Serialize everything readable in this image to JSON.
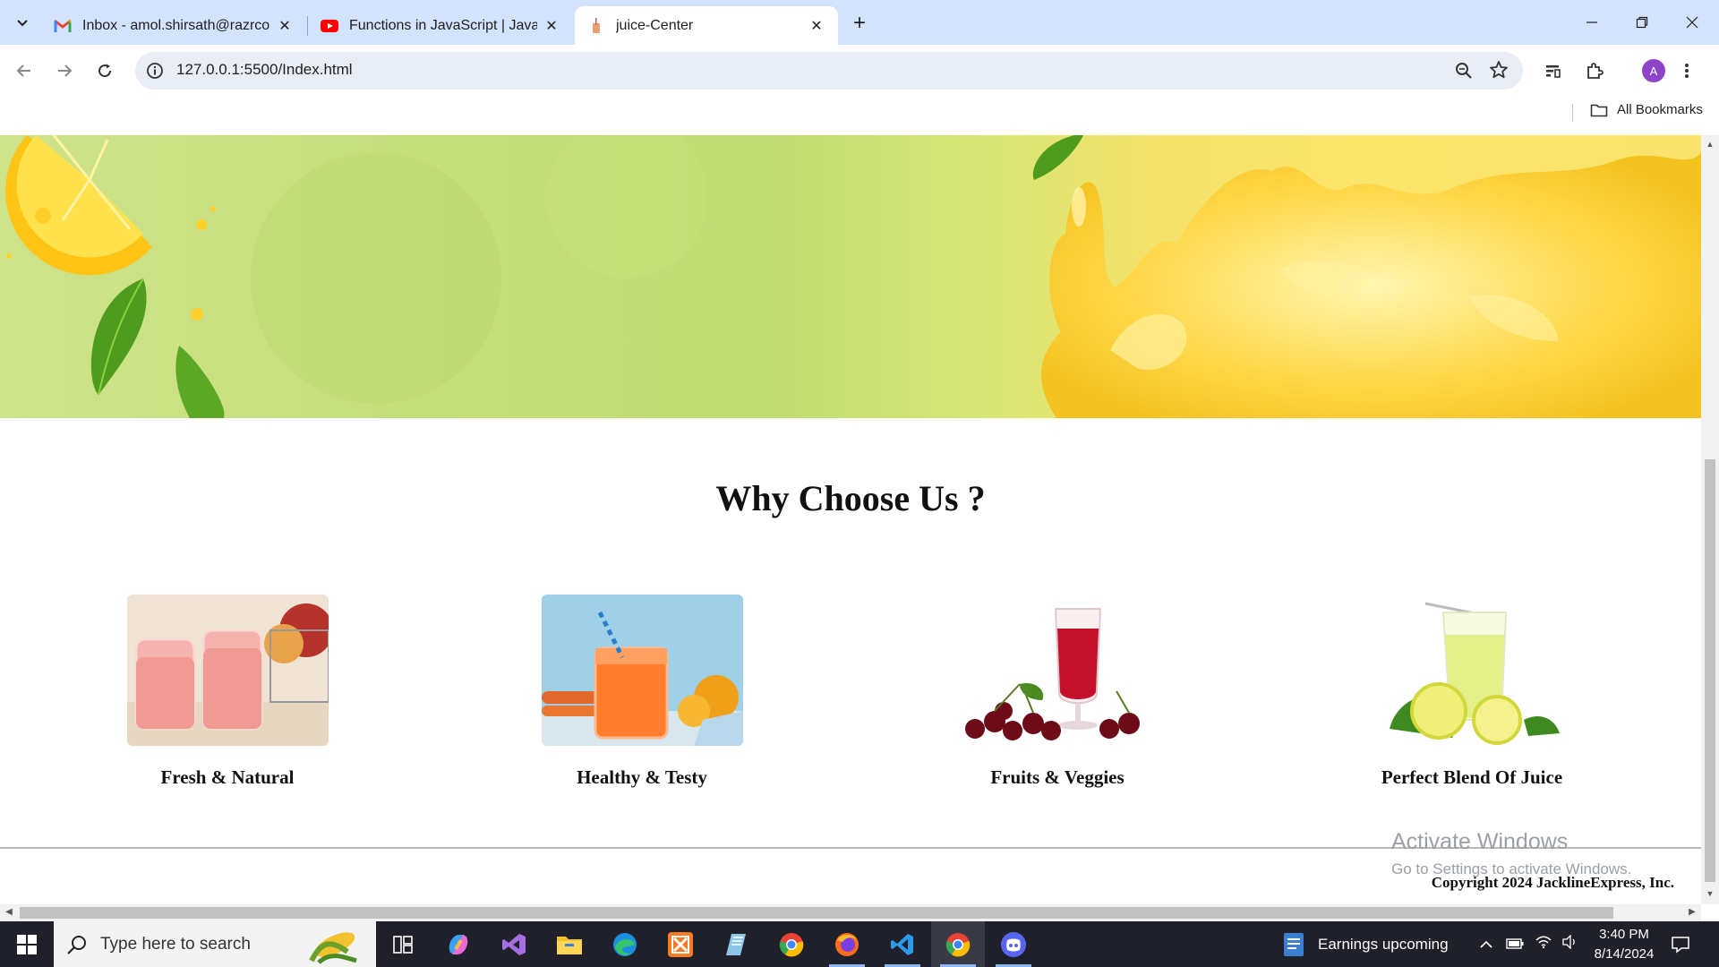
{
  "browser": {
    "tabs": [
      {
        "title": "Inbox - amol.shirsath@razrcorp",
        "favicon": "gmail-icon",
        "active": false
      },
      {
        "title": "Functions in JavaScript | JavaScr",
        "favicon": "youtube-icon",
        "active": false
      },
      {
        "title": "juice-Center",
        "favicon": "juice-icon",
        "active": true
      }
    ],
    "url": "127.0.0.1:5500/Index.html",
    "profile_initial": "A",
    "bookmarks_label": "All Bookmarks",
    "colors": {
      "tabstrip": "#d3e3fd",
      "omnibox": "#e9eef6",
      "avatar": "#8e44c8"
    }
  },
  "page": {
    "section_title": "Why Choose Us ?",
    "features": [
      {
        "caption": "Fresh & Natural",
        "image": "pink-juice-glasses"
      },
      {
        "caption": "Healthy & Testy",
        "image": "orange-carrot-juice"
      },
      {
        "caption": "Fruits & Veggies",
        "image": "cherry-juice"
      },
      {
        "caption": "Perfect Blend Of Juice",
        "image": "lemonade-glass"
      }
    ],
    "copyright": "Copyright 2024 JacklineExpress, Inc."
  },
  "watermark": {
    "line1": "Activate Windows",
    "line2": "Go to Settings to activate Windows."
  },
  "taskbar": {
    "search_placeholder": "Type here to search",
    "apps": [
      "task-view",
      "copilot",
      "visual-studio",
      "file-explorer",
      "edge",
      "xampp",
      "notepad",
      "chrome",
      "firefox",
      "vscode",
      "chrome-active",
      "discord"
    ],
    "widget_text": "Earnings upcoming",
    "time": "3:40 PM",
    "date": "8/14/2024"
  }
}
